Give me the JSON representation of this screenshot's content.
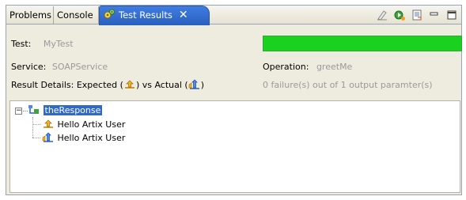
{
  "tabs": [
    {
      "label": "Problems",
      "active": false
    },
    {
      "label": "Console",
      "active": false
    },
    {
      "label": "Test Results",
      "active": true
    }
  ],
  "tab_close_glyph": "✕",
  "toolbar_icons": [
    "clear-icon",
    "run-icon",
    "export-icon",
    "minimize-icon",
    "maximize-icon"
  ],
  "test": {
    "label": "Test:",
    "value": "MyTest"
  },
  "service": {
    "label": "Service:",
    "value": "SOAPService"
  },
  "operation": {
    "label": "Operation:",
    "value": "greetMe"
  },
  "result_details": {
    "prefix": "Result Details:  Expected (",
    "middle": ") vs Actual (",
    "suffix": ")",
    "summary": "0 failure(s) out of 1 output paramter(s)"
  },
  "progress": {
    "fraction": 1.0,
    "color": "#19d11e"
  },
  "tree": {
    "expander_glyph": "−",
    "root": "theResponse",
    "children": [
      {
        "kind": "expected",
        "text": "Hello Artix User"
      },
      {
        "kind": "actual",
        "text": "Hello Artix User"
      }
    ]
  },
  "colors": {
    "accent": "#316ac5",
    "tab_active": "#3f7de0",
    "pass": "#19d11e"
  }
}
